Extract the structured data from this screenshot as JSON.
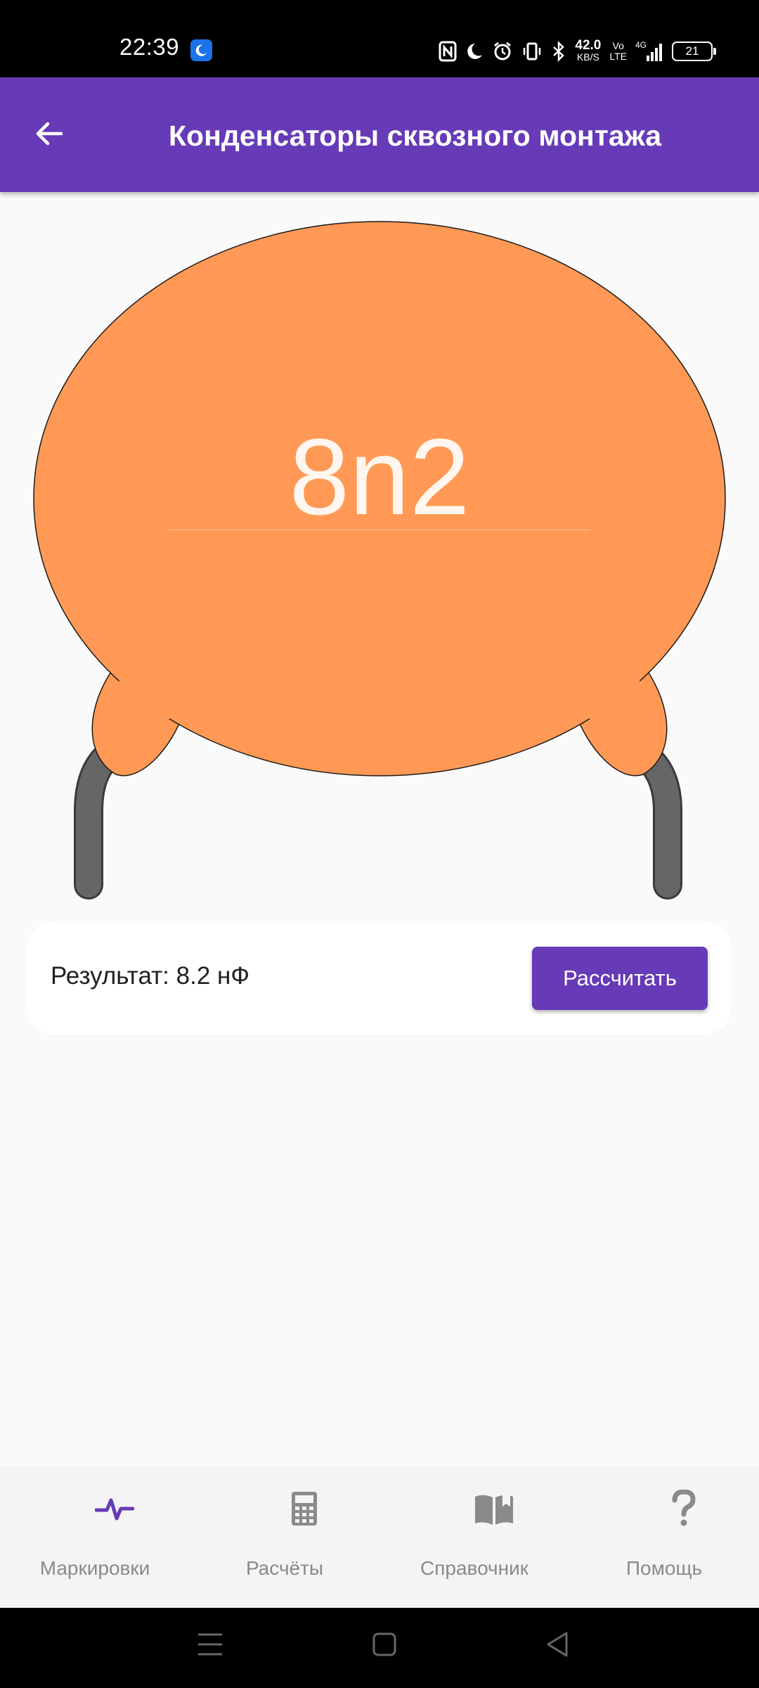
{
  "status_bar": {
    "time": "22:39",
    "net_speed_value": "42.0",
    "net_speed_unit": "KB/S",
    "volte_top": "Vo",
    "volte_bottom": "LTE",
    "network_type": "4G",
    "battery_level": "21"
  },
  "app_bar": {
    "title": "Конденсаторы сквозного монтажа",
    "back_icon": "arrow-left-icon"
  },
  "capacitor": {
    "marking": "8n2",
    "body_color": "#ff9955",
    "lead_color": "#666666"
  },
  "result": {
    "text": "Результат: 8.2 нФ",
    "button_label": "Рассчитать"
  },
  "bottom_nav": {
    "items": [
      {
        "label": "Маркировки",
        "icon": "pulse-icon",
        "active": true
      },
      {
        "label": "Расчёты",
        "icon": "calculator-icon",
        "active": false
      },
      {
        "label": "Справочник",
        "icon": "book-icon",
        "active": false
      },
      {
        "label": "Помощь",
        "icon": "question-icon",
        "active": false
      }
    ]
  },
  "colors": {
    "primary": "#673ab7",
    "background": "#fafafa",
    "inactive": "#8a8a8a"
  }
}
